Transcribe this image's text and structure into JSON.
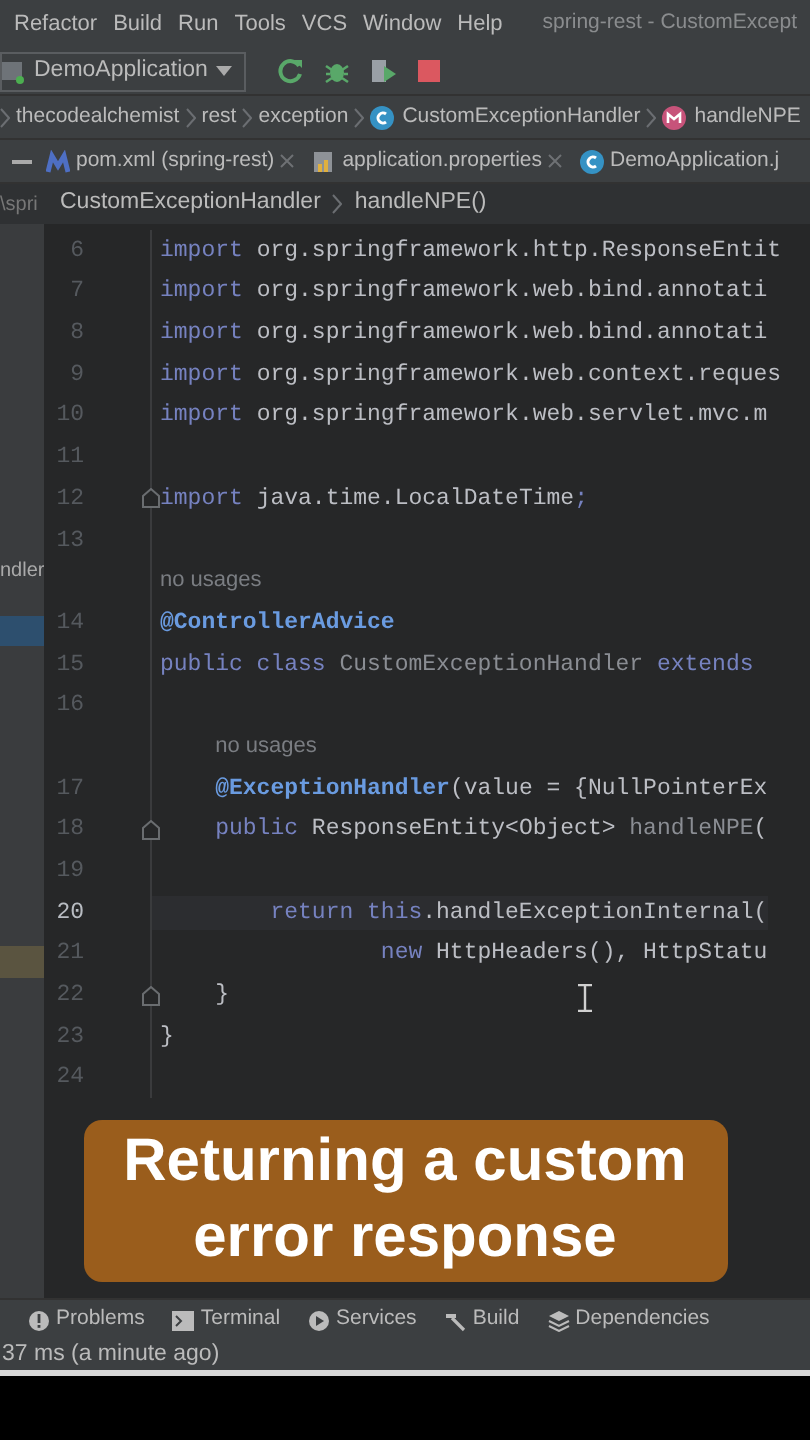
{
  "menu": {
    "items": [
      "Refactor",
      "Build",
      "Run",
      "Tools",
      "VCS",
      "Window",
      "Help"
    ],
    "title": "spring-rest - CustomExcept"
  },
  "toolbar": {
    "run_config": "DemoApplication"
  },
  "navigation": [
    {
      "label": "thecodealchemist",
      "kind": "package"
    },
    {
      "label": "rest",
      "kind": "package"
    },
    {
      "label": "exception",
      "kind": "package"
    },
    {
      "label": "CustomExceptionHandler",
      "kind": "class"
    },
    {
      "label": "handleNPE",
      "kind": "method"
    }
  ],
  "tabs": [
    {
      "label": "pom.xml (spring-rest)",
      "kind": "maven",
      "closable": true
    },
    {
      "label": "application.properties",
      "kind": "properties",
      "closable": true
    },
    {
      "label": "DemoApplication.j",
      "kind": "class",
      "closable": false
    }
  ],
  "editor_breadcrumb": {
    "path_fragment": "\\spri",
    "items": [
      "CustomExceptionHandler",
      "handleNPE()"
    ]
  },
  "project_tree": {
    "visible_text": "ndler"
  },
  "editor": {
    "lines": [
      {
        "kind": "code",
        "number": "6",
        "current": false,
        "fold": false,
        "tokens": [
          {
            "text": "import",
            "kind": "keyword"
          },
          {
            "text": " org.springframework.http.ResponseEntit",
            "kind": "plain"
          }
        ]
      },
      {
        "kind": "code",
        "number": "7",
        "current": false,
        "fold": false,
        "tokens": [
          {
            "text": "import",
            "kind": "keyword"
          },
          {
            "text": " org.springframework.web.bind.annotati",
            "kind": "plain"
          }
        ]
      },
      {
        "kind": "code",
        "number": "8",
        "current": false,
        "fold": false,
        "tokens": [
          {
            "text": "import",
            "kind": "keyword"
          },
          {
            "text": " org.springframework.web.bind.annotati",
            "kind": "plain"
          }
        ]
      },
      {
        "kind": "code",
        "number": "9",
        "current": false,
        "fold": false,
        "tokens": [
          {
            "text": "import",
            "kind": "keyword"
          },
          {
            "text": " org.springframework.web.context.reques",
            "kind": "plain"
          }
        ]
      },
      {
        "kind": "code",
        "number": "10",
        "current": false,
        "fold": false,
        "tokens": [
          {
            "text": "import",
            "kind": "keyword"
          },
          {
            "text": " org.springframework.web.servlet.mvc.m",
            "kind": "plain"
          }
        ]
      },
      {
        "kind": "code",
        "number": "11",
        "current": false,
        "fold": false
      },
      {
        "kind": "code",
        "number": "12",
        "current": false,
        "fold": true,
        "tokens": [
          {
            "text": "import",
            "kind": "keyword"
          },
          {
            "text": " java.time.LocalDateTime",
            "kind": "plain"
          },
          {
            "text": ";",
            "kind": "keyword"
          }
        ]
      },
      {
        "kind": "code",
        "number": "13",
        "current": false,
        "fold": false
      },
      {
        "kind": "hint",
        "text": "no usages"
      },
      {
        "kind": "code",
        "number": "14",
        "current": false,
        "fold": false,
        "tokens": [
          {
            "text": "@ControllerAdvice",
            "kind": "annotation"
          }
        ]
      },
      {
        "kind": "code",
        "number": "15",
        "current": false,
        "fold": false,
        "tokens": [
          {
            "text": "public class ",
            "kind": "keyword"
          },
          {
            "text": "CustomExceptionHandler",
            "kind": "unused"
          },
          {
            "text": " extends",
            "kind": "keyword"
          }
        ]
      },
      {
        "kind": "code",
        "number": "16",
        "current": false,
        "fold": false
      },
      {
        "kind": "hint",
        "text": "no usages"
      },
      {
        "kind": "code",
        "number": "17",
        "current": false,
        "fold": false,
        "tokens": [
          {
            "text": "    @ExceptionHandler",
            "kind": "annotation"
          },
          {
            "text": "(value = {NullPointerEx",
            "kind": "plain"
          }
        ]
      },
      {
        "kind": "code",
        "number": "18",
        "current": false,
        "fold": true,
        "tokens": [
          {
            "text": "    public ",
            "kind": "keyword"
          },
          {
            "text": "ResponseEntity<Object> ",
            "kind": "plain"
          },
          {
            "text": "handleNPE",
            "kind": "unused"
          },
          {
            "text": "(",
            "kind": "plain"
          }
        ]
      },
      {
        "kind": "code",
        "number": "19",
        "current": false,
        "fold": false
      },
      {
        "kind": "code",
        "number": "20",
        "current": true,
        "fold": false,
        "tokens": [
          {
            "text": "        return this",
            "kind": "keyword"
          },
          {
            "text": ".handleExceptionInternal(",
            "kind": "plain"
          }
        ]
      },
      {
        "kind": "code",
        "number": "21",
        "current": false,
        "fold": false,
        "tokens": [
          {
            "text": "                new ",
            "kind": "keyword"
          },
          {
            "text": "HttpHeaders(), HttpStatu",
            "kind": "plain"
          }
        ]
      },
      {
        "kind": "code",
        "number": "22",
        "current": false,
        "fold": true,
        "tokens": [
          {
            "text": "    }",
            "kind": "plain"
          }
        ]
      },
      {
        "kind": "code",
        "number": "23",
        "current": false,
        "fold": false,
        "tokens": [
          {
            "text": "}",
            "kind": "plain"
          }
        ]
      },
      {
        "kind": "code",
        "number": "24",
        "current": false,
        "fold": false
      }
    ]
  },
  "caption": {
    "text": "Returning a custom error response"
  },
  "tool_windows": [
    {
      "label": "Problems",
      "kind": "problems"
    },
    {
      "label": "Terminal",
      "kind": "terminal"
    },
    {
      "label": "Services",
      "kind": "services"
    },
    {
      "label": "Build",
      "kind": "build"
    },
    {
      "label": "Dependencies",
      "kind": "dependencies"
    }
  ],
  "status_bar": {
    "text": "37 ms (a minute ago)"
  }
}
